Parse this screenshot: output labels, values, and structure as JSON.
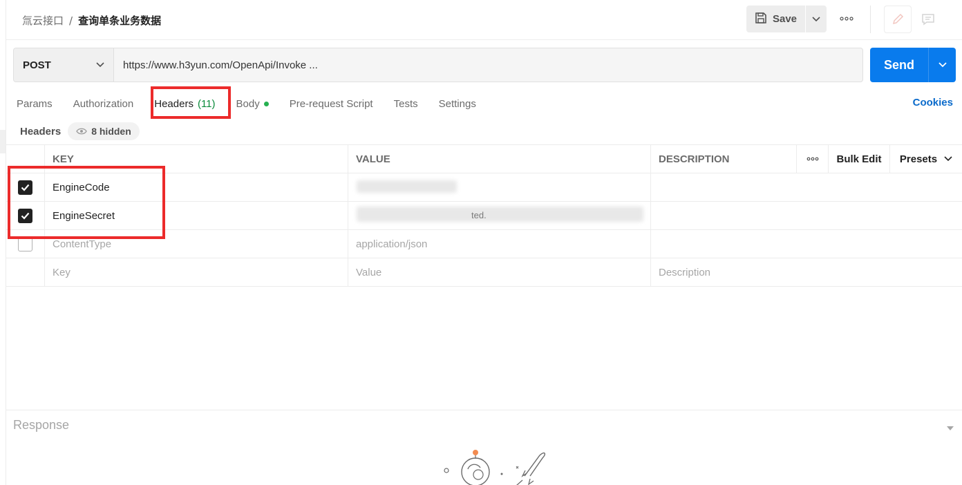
{
  "breadcrumb": {
    "parent": "氚云接口",
    "separator": "/",
    "current": "查询单条业务数据"
  },
  "toolbar": {
    "save_label": "Save",
    "save_icon": "floppy-disk-icon",
    "more_icon": "ellipsis-icon",
    "edit_icon": "pencil-icon",
    "comment_icon": "comment-icon"
  },
  "request": {
    "method": "POST",
    "url": "https://www.h3yun.com/OpenApi/Invoke ..."
  },
  "send": {
    "label": "Send",
    "color": "#097bed"
  },
  "tabs": [
    {
      "label": "Params"
    },
    {
      "label": "Authorization"
    },
    {
      "label": "Headers",
      "count": "(11)",
      "active": true
    },
    {
      "label": "Body",
      "has_dot": true
    },
    {
      "label": "Pre-request Script"
    },
    {
      "label": "Tests"
    },
    {
      "label": "Settings"
    }
  ],
  "cookies_label": "Cookies",
  "headers_section": {
    "label": "Headers",
    "hidden_label": "8 hidden"
  },
  "table": {
    "columns": {
      "key": "KEY",
      "value": "VALUE",
      "description": "DESCRIPTION"
    },
    "bulk_edit": "Bulk Edit",
    "presets": "Presets",
    "rows": [
      {
        "checked": true,
        "key": "EngineCode",
        "value": "",
        "description": ""
      },
      {
        "checked": true,
        "key": "EngineSecret",
        "value": "ted.",
        "description": ""
      },
      {
        "checked": false,
        "key": "ContentType",
        "value": "application/json",
        "description": ""
      }
    ],
    "placeholder": {
      "key": "Key",
      "value": "Value",
      "description": "Description"
    }
  },
  "response": {
    "label": "Response"
  },
  "colors": {
    "annotation_red": "#ec2b2b",
    "checkbox_on": "#212121",
    "link_blue": "#0b6bcb"
  }
}
